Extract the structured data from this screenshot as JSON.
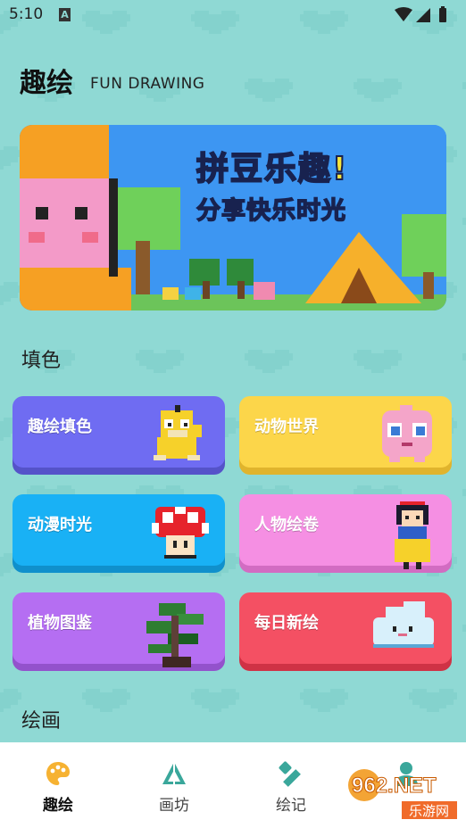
{
  "status": {
    "time": "5:10",
    "notif_badge": "A"
  },
  "header": {
    "title": "趣绘",
    "subtitle": "FUN DRAWING"
  },
  "banner": {
    "line1": "拼豆乐趣!",
    "line2": "分享快乐时光"
  },
  "sections": {
    "coloring": "填色",
    "drawing": "绘画"
  },
  "cards": [
    {
      "label": "趣绘填色",
      "color": "#6f6cf2",
      "shade": "#5553c9",
      "icon": "duck-icon"
    },
    {
      "label": "动物世界",
      "color": "#fcd64a",
      "shade": "#e0b42d",
      "icon": "pink-balloon-icon"
    },
    {
      "label": "动漫时光",
      "color": "#19b1f5",
      "shade": "#1090cc",
      "icon": "mushroom-icon"
    },
    {
      "label": "人物绘卷",
      "color": "#f58fe3",
      "shade": "#d26cc2",
      "icon": "princess-icon"
    },
    {
      "label": "植物图鉴",
      "color": "#b56ef2",
      "shade": "#9352cc",
      "icon": "bonsai-icon"
    },
    {
      "label": "每日新绘",
      "color": "#f45063",
      "shade": "#cf3245",
      "icon": "cloud-icon"
    }
  ],
  "nav": [
    {
      "label": "趣绘",
      "icon": "palette-icon",
      "active": true
    },
    {
      "label": "画坊",
      "icon": "triangle-icon",
      "active": false
    },
    {
      "label": "绘记",
      "icon": "pencil-icon",
      "active": false
    },
    {
      "label": "",
      "icon": "person-icon",
      "active": false
    }
  ],
  "watermark": {
    "brand": "962.NET",
    "sub": "乐游网"
  }
}
